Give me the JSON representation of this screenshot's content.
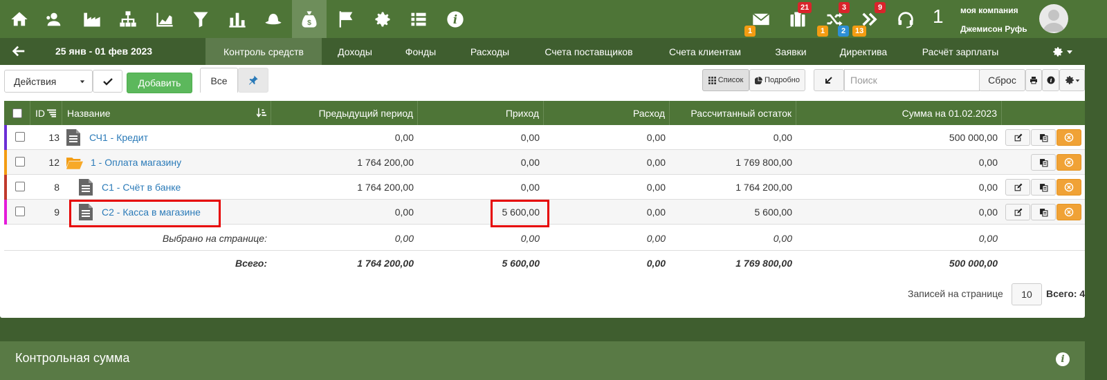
{
  "topnav": {
    "icons": [
      "home-icon",
      "users-icon",
      "factory-icon",
      "org-chart-icon",
      "area-chart-icon",
      "funnel-icon",
      "bar-chart-icon",
      "hat-icon",
      "money-bag-icon",
      "flag-icon",
      "gear-icon",
      "list-icon",
      "info-icon"
    ],
    "active_index": 8,
    "badges": {
      "mail": "1",
      "tasks": "21",
      "shuffle_top": "3",
      "shuffle_orange": "1",
      "shuffle_blue": "2",
      "forward_orange": "13",
      "forward_top": "9"
    },
    "user_number": "1",
    "company": "моя компания",
    "username": "Джемисон Руфь"
  },
  "subnav": {
    "date_range": "25 янв - 01 фев 2023",
    "tabs": [
      "Контроль средств",
      "Доходы",
      "Фонды",
      "Расходы",
      "Счета поставщиков",
      "Счета клиентам",
      "Заявки",
      "Директива",
      "Расчёт зарплаты"
    ],
    "active_tab": 0
  },
  "toolbar": {
    "actions_label": "Действия",
    "add_label": "Добавить",
    "all_label": "Все",
    "list_view_label": "Список",
    "detail_view_label": "Подробно",
    "search_placeholder": "Поиск",
    "reset_label": "Сброс"
  },
  "table": {
    "headers": {
      "id": "ID",
      "name": "Название",
      "prev": "Предыдущий период",
      "income": "Приход",
      "expense": "Расход",
      "balance": "Рассчитанный остаток",
      "sum": "Сумма на 01.02.2023"
    },
    "rows": [
      {
        "id": "13",
        "name": "СЧ1 - Кредит",
        "prev": "0,00",
        "income": "0,00",
        "expense": "0,00",
        "balance": "0,00",
        "sum": "500 000,00"
      },
      {
        "id": "12",
        "name": "1 - Оплата магазину",
        "prev": "1 764 200,00",
        "income": "0,00",
        "expense": "0,00",
        "balance": "1 769 800,00",
        "sum": "0,00"
      },
      {
        "id": "8",
        "name": "С1 - Счёт в банке",
        "prev": "1 764 200,00",
        "income": "0,00",
        "expense": "0,00",
        "balance": "1 764 200,00",
        "sum": "0,00"
      },
      {
        "id": "9",
        "name": "С2 - Касса в магазине",
        "prev": "0,00",
        "income": "5 600,00",
        "expense": "0,00",
        "balance": "5 600,00",
        "sum": "0,00"
      }
    ],
    "selected": {
      "label": "Выбрано на странице:",
      "prev": "0,00",
      "income": "0,00",
      "expense": "0,00",
      "balance": "0,00",
      "sum": "0,00"
    },
    "total": {
      "label": "Всего:",
      "prev": "1 764 200,00",
      "income": "5 600,00",
      "expense": "0,00",
      "balance": "1 769 800,00",
      "sum": "500 000,00"
    }
  },
  "pager": {
    "per_page_label": "Записей на странице",
    "per_page_value": "10",
    "total_label": "Всего: 4"
  },
  "bottom_panel": {
    "title": "Контрольная сумма"
  },
  "colors": {
    "nav_green": "#4e7537",
    "dark_green": "#3f5e2f",
    "link_blue": "#2a7ab8",
    "highlight_red": "#e60000",
    "row_bar_purple": "#6b2fd6",
    "row_bar_orange": "#f39c12",
    "row_bar_red": "#c0392b",
    "row_bar_magenta": "#e41bd9"
  }
}
